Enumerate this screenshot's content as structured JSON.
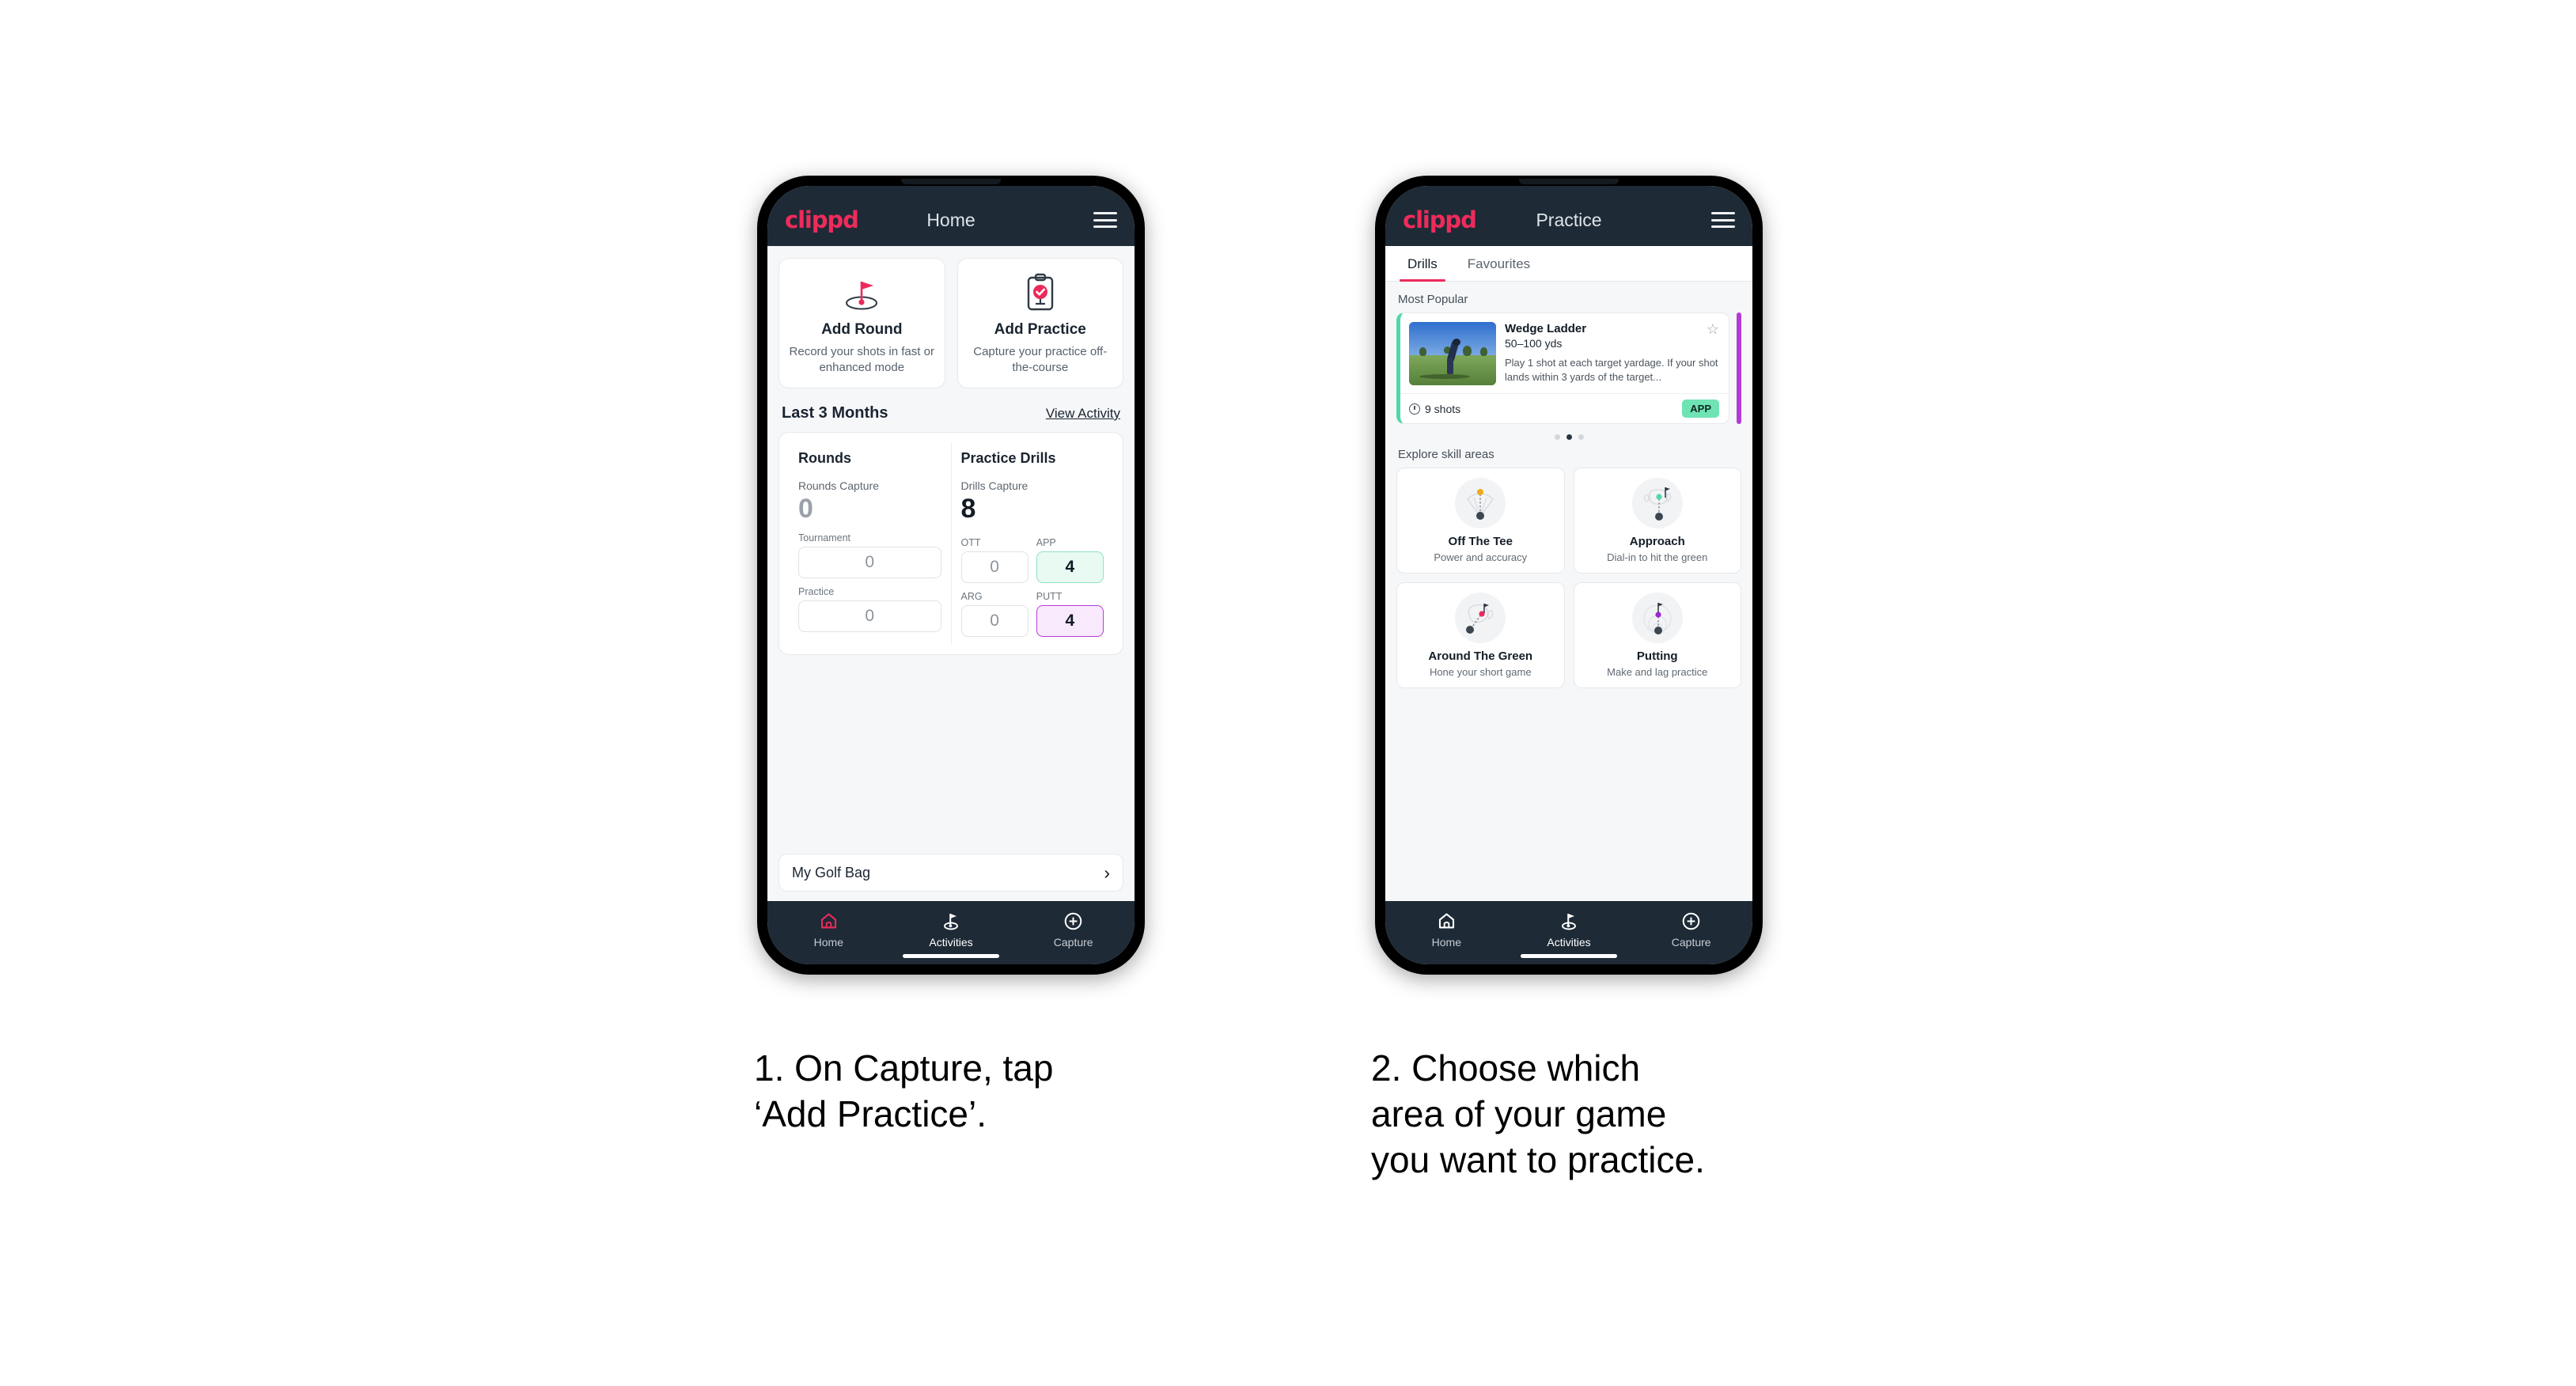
{
  "phone1": {
    "appbar": {
      "brand": "clippd",
      "title": "Home",
      "menu_icon": "hamburger-icon"
    },
    "actions": [
      {
        "icon": "golf-flag-hole-icon",
        "title": "Add Round",
        "subtitle": "Record your shots in fast or enhanced mode"
      },
      {
        "icon": "clipboard-check-icon",
        "title": "Add Practice",
        "subtitle": "Capture your practice off-the-course"
      }
    ],
    "section": {
      "title": "Last 3 Months",
      "link": "View Activity"
    },
    "stats": {
      "rounds": {
        "heading": "Rounds",
        "capture_label": "Rounds Capture",
        "capture_value": "0",
        "fields": [
          {
            "label": "Tournament",
            "value": "0",
            "highlight": "none"
          },
          {
            "label": "Practice",
            "value": "0",
            "highlight": "none"
          }
        ]
      },
      "drills": {
        "heading": "Practice Drills",
        "capture_label": "Drills Capture",
        "capture_value": "8",
        "fields": [
          {
            "label": "OTT",
            "value": "0",
            "highlight": "none"
          },
          {
            "label": "APP",
            "value": "4",
            "highlight": "green"
          },
          {
            "label": "ARG",
            "value": "0",
            "highlight": "none"
          },
          {
            "label": "PUTT",
            "value": "4",
            "highlight": "purple"
          }
        ]
      }
    },
    "golf_bag": {
      "label": "My Golf Bag",
      "chevron": "chevron-right-icon"
    },
    "bottom_nav": [
      {
        "icon": "home-icon",
        "label": "Home",
        "active": true
      },
      {
        "icon": "golf-flag-icon",
        "label": "Activities",
        "active": false
      },
      {
        "icon": "plus-circle-icon",
        "label": "Capture",
        "active": false
      }
    ]
  },
  "phone2": {
    "appbar": {
      "brand": "clippd",
      "title": "Practice",
      "menu_icon": "hamburger-icon"
    },
    "tabs": [
      {
        "label": "Drills",
        "active": true
      },
      {
        "label": "Favourites",
        "active": false
      }
    ],
    "most_popular_label": "Most Popular",
    "drill": {
      "title": "Wedge Ladder",
      "yardage": "50–100 yds",
      "description": "Play 1 shot at each target yardage. If your shot lands within 3 yards of the target...",
      "shots": "9 shots",
      "badge": "APP",
      "favourite_icon": "star-outline-icon",
      "shots_icon": "clock-icon",
      "accent_color": "#4fd8a6",
      "next_card_accent": "#b33bd6",
      "thumbnail": "golfer-wedge-shot-photo"
    },
    "carousel_dots": {
      "count": 3,
      "active_index": 1
    },
    "explore_label": "Explore skill areas",
    "skill_areas": [
      {
        "icon": "off-the-tee-icon",
        "title": "Off The Tee",
        "subtitle": "Power and accuracy",
        "dot_color": "#f0a91e"
      },
      {
        "icon": "approach-icon",
        "title": "Approach",
        "subtitle": "Dial-in to hit the green",
        "dot_color": "#4fd8a6"
      },
      {
        "icon": "around-the-green-icon",
        "title": "Around The Green",
        "subtitle": "Hone your short game",
        "dot_color": "#ec2a5b"
      },
      {
        "icon": "putting-icon",
        "title": "Putting",
        "subtitle": "Make and lag practice",
        "dot_color": "#9c27d0"
      }
    ],
    "bottom_nav": [
      {
        "icon": "home-icon",
        "label": "Home",
        "active": false
      },
      {
        "icon": "golf-flag-icon",
        "label": "Activities",
        "active": true
      },
      {
        "icon": "plus-circle-icon",
        "label": "Capture",
        "active": false
      }
    ]
  },
  "captions": {
    "step1": "1. On Capture, tap\n‘Add Practice’.",
    "step2": "2. Choose which\narea of your game\nyou want to practice."
  },
  "colors": {
    "brand_pink": "#ec2a5b",
    "nav_dark": "#1e2a36",
    "page_bg": "#f6f7f9",
    "green_accent": "#4fd8a6",
    "purple_accent": "#b33bd6"
  }
}
